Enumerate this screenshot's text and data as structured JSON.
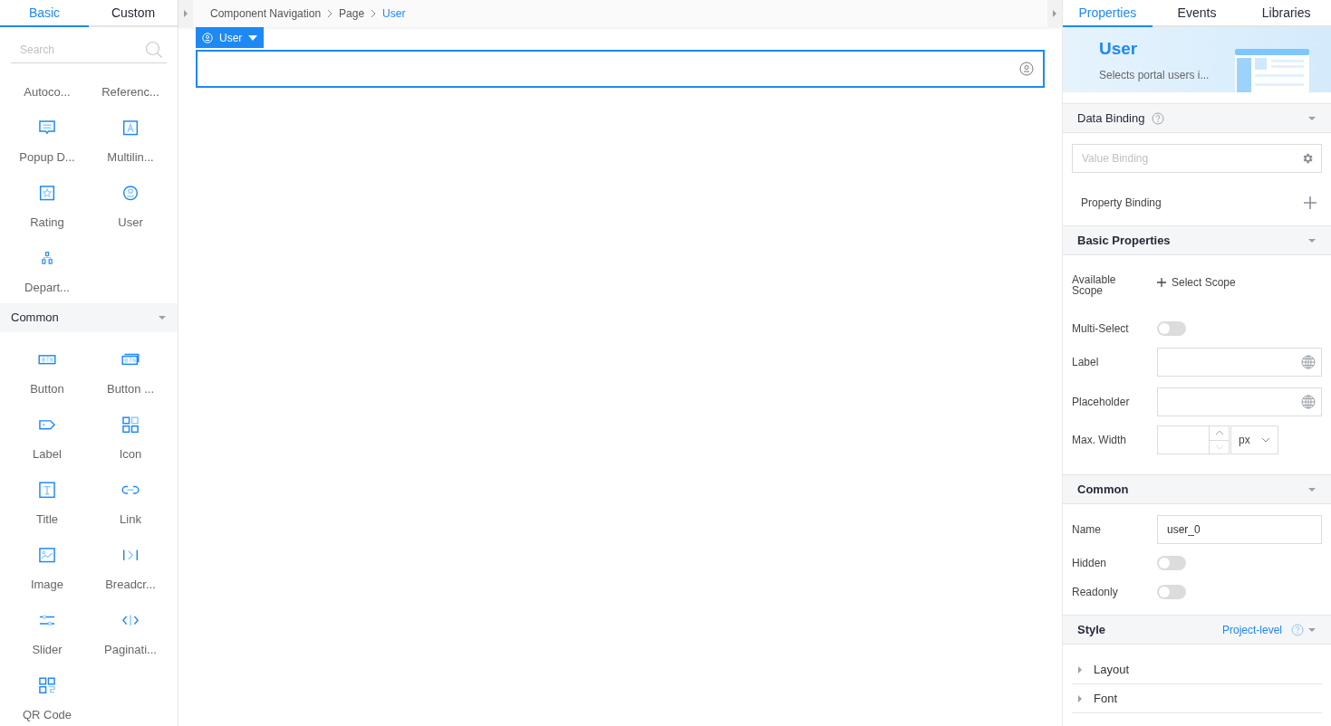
{
  "left_tabs": [
    {
      "label": "Basic",
      "selected": true
    },
    {
      "label": "Custom",
      "selected": false
    }
  ],
  "search": {
    "placeholder": "Search"
  },
  "basic_components": [
    {
      "label": "Autoco..."
    },
    {
      "label": "Referenc..."
    },
    {
      "label": "Popup D..."
    },
    {
      "label": "Multilin..."
    },
    {
      "label": "Rating"
    },
    {
      "label": "User"
    },
    {
      "label": "Depart..."
    }
  ],
  "common_section": {
    "title": "Common",
    "expanded": true,
    "components": [
      {
        "label": "Button"
      },
      {
        "label": "Button ..."
      },
      {
        "label": "Label"
      },
      {
        "label": "Icon"
      },
      {
        "label": "Title"
      },
      {
        "label": "Link"
      },
      {
        "label": "Image"
      },
      {
        "label": "Breadcr..."
      },
      {
        "label": "Slider"
      },
      {
        "label": "Paginati..."
      },
      {
        "label": "QR Code"
      }
    ]
  },
  "breadcrumb": [
    {
      "label": "Component Navigation",
      "selected": false
    },
    {
      "label": "Page",
      "selected": false
    },
    {
      "label": "User",
      "selected": true
    }
  ],
  "canvas": {
    "component_tag": "User"
  },
  "right_tabs": [
    {
      "label": "Properties",
      "selected": true
    },
    {
      "label": "Events",
      "selected": false
    },
    {
      "label": "Libraries",
      "selected": false
    }
  ],
  "banner": {
    "title": "User",
    "description": "Selects portal users i..."
  },
  "data_binding": {
    "title": "Data Binding",
    "value_binding_placeholder": "Value Binding",
    "property_binding": "Property Binding"
  },
  "basic_properties": {
    "title": "Basic Properties",
    "available_scope_label": "Available Scope",
    "select_scope": "Select Scope",
    "multi_select": {
      "label": "Multi-Select",
      "on": false
    },
    "label_field": {
      "label": "Label"
    },
    "placeholder_field": {
      "label": "Placeholder"
    },
    "max_width": {
      "label": "Max. Width",
      "unit": "px"
    }
  },
  "common": {
    "title": "Common",
    "name": {
      "label": "Name",
      "value": "user_0"
    },
    "hidden": {
      "label": "Hidden",
      "on": false
    },
    "readonly": {
      "label": "Readonly",
      "on": false
    }
  },
  "style": {
    "title": "Style",
    "scope": "Project-level",
    "groups": [
      {
        "label": "Layout",
        "expanded": false
      },
      {
        "label": "Font",
        "expanded": false
      }
    ]
  }
}
